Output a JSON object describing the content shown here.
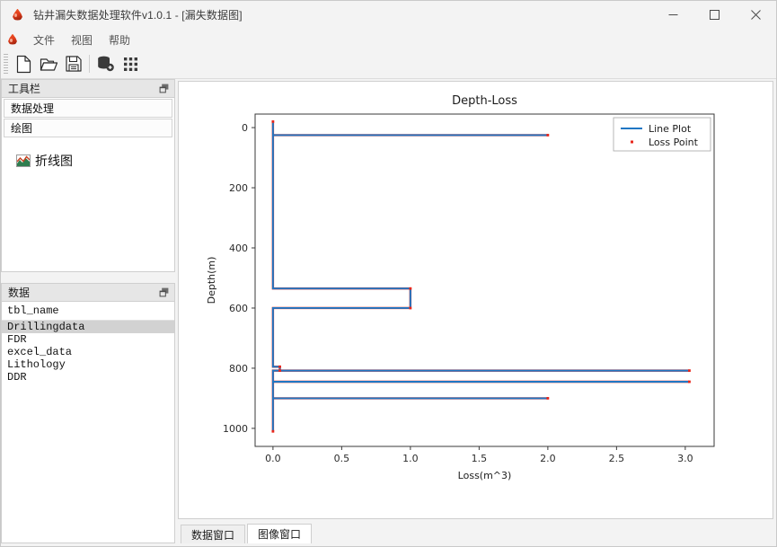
{
  "window": {
    "title": "钻井漏失数据处理软件v1.0.1 - [漏失数据图]",
    "app_icon": "droplet-icon",
    "minimize_label": "—",
    "maximize_label": "□",
    "close_label": "✕"
  },
  "menubar": {
    "app_icon": "droplet-icon",
    "items": [
      {
        "label": "文件",
        "name": "menu-file"
      },
      {
        "label": "视图",
        "name": "menu-view"
      },
      {
        "label": "帮助",
        "name": "menu-help"
      }
    ]
  },
  "toolbar": {
    "buttons": [
      {
        "icon": "new-file-icon",
        "name": "toolbar-new"
      },
      {
        "icon": "open-folder-icon",
        "name": "toolbar-open"
      },
      {
        "icon": "save-disk-icon",
        "name": "toolbar-save"
      },
      {
        "icon": "database-connect-icon",
        "name": "toolbar-database"
      },
      {
        "icon": "grid-table-icon",
        "name": "toolbar-grid"
      }
    ]
  },
  "toolpanel": {
    "title": "工具栏",
    "float_icon": "float-window-icon",
    "groups": [
      {
        "label": "数据处理",
        "name": "group-data-processing"
      },
      {
        "label": "绘图",
        "name": "group-plotting"
      }
    ],
    "plot_entry": {
      "label": "折线图",
      "icon": "line-chart-icon"
    }
  },
  "datapanel": {
    "title": "数据",
    "float_icon": "float-window-icon",
    "column_header": "tbl_name",
    "rows": [
      {
        "label": "Drillingdata",
        "selected": true
      },
      {
        "label": "FDR",
        "selected": false
      },
      {
        "label": "excel_data",
        "selected": false
      },
      {
        "label": "Lithology",
        "selected": false
      },
      {
        "label": "DDR",
        "selected": false
      }
    ]
  },
  "tabs": [
    {
      "label": "数据窗口",
      "active": false,
      "name": "tab-data-window"
    },
    {
      "label": "图像窗口",
      "active": true,
      "name": "tab-image-window"
    }
  ],
  "chart_data": {
    "type": "line",
    "title": "Depth-Loss",
    "xlabel": "Loss(m^3)",
    "ylabel": "Depth(m)",
    "xlim": [
      -0.13,
      3.21
    ],
    "ylim": [
      1060,
      -45
    ],
    "y_inverted": true,
    "grid": false,
    "xticks": [
      0.0,
      0.5,
      1.0,
      1.5,
      2.0,
      2.5,
      3.0
    ],
    "xticklabels": [
      "0.0",
      "0.5",
      "1.0",
      "1.5",
      "2.0",
      "2.5",
      "3.0"
    ],
    "yticks": [
      0,
      200,
      400,
      600,
      800,
      1000
    ],
    "yticklabels": [
      "0",
      "200",
      "400",
      "600",
      "800",
      "1000"
    ],
    "legend": {
      "position": "upper right",
      "entries": [
        {
          "label": "Line Plot",
          "marker": "line",
          "color": "#1f77c4"
        },
        {
          "label": "Loss Point",
          "marker": "point",
          "color": "#e8261b"
        }
      ]
    },
    "series": [
      {
        "name": "Line Plot",
        "color": "#1f77c4",
        "xlabel_axis": "Loss(m^3)",
        "ylabel_axis": "Depth(m)",
        "points": [
          {
            "loss": 0.0,
            "depth": -20
          },
          {
            "loss": 0.0,
            "depth": 25
          },
          {
            "loss": 2.0,
            "depth": 25
          },
          {
            "loss": 0.0,
            "depth": 25
          },
          {
            "loss": 0.0,
            "depth": 535
          },
          {
            "loss": 1.0,
            "depth": 535
          },
          {
            "loss": 1.0,
            "depth": 600
          },
          {
            "loss": 0.0,
            "depth": 600
          },
          {
            "loss": 0.0,
            "depth": 795
          },
          {
            "loss": 0.05,
            "depth": 795
          },
          {
            "loss": 0.05,
            "depth": 808
          },
          {
            "loss": 0.0,
            "depth": 808
          },
          {
            "loss": 3.03,
            "depth": 808
          },
          {
            "loss": 0.0,
            "depth": 808
          },
          {
            "loss": 0.0,
            "depth": 845
          },
          {
            "loss": 3.03,
            "depth": 845
          },
          {
            "loss": 0.0,
            "depth": 845
          },
          {
            "loss": 0.0,
            "depth": 900
          },
          {
            "loss": 2.0,
            "depth": 900
          },
          {
            "loss": 0.0,
            "depth": 900
          },
          {
            "loss": 0.0,
            "depth": 1010
          }
        ]
      },
      {
        "name": "Loss Point",
        "color": "#e8261b",
        "points": [
          {
            "loss": 0.0,
            "depth": -20
          },
          {
            "loss": 2.0,
            "depth": 25
          },
          {
            "loss": 1.0,
            "depth": 535
          },
          {
            "loss": 1.0,
            "depth": 600
          },
          {
            "loss": 0.05,
            "depth": 795
          },
          {
            "loss": 0.05,
            "depth": 808
          },
          {
            "loss": 3.03,
            "depth": 808
          },
          {
            "loss": 3.03,
            "depth": 845
          },
          {
            "loss": 2.0,
            "depth": 900
          },
          {
            "loss": 0.0,
            "depth": 1010
          }
        ]
      }
    ]
  }
}
